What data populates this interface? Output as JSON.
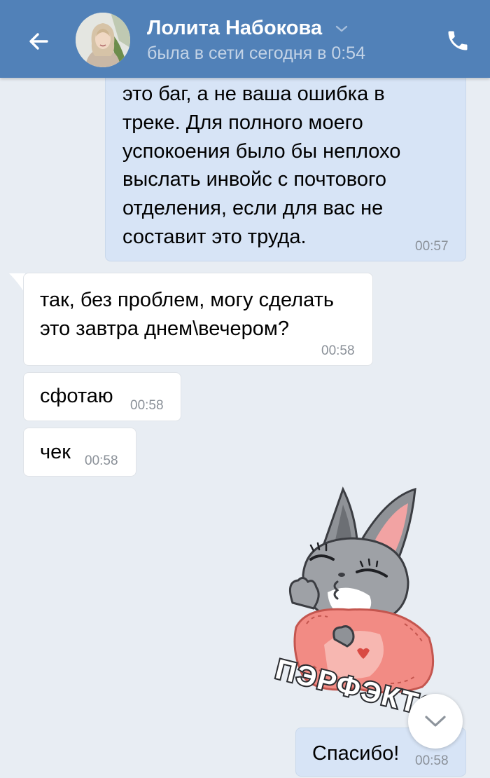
{
  "header": {
    "contact_name": "Лолита Набокова",
    "status": "была в сети сегодня в 0:54",
    "back_icon": "arrow-left-icon",
    "phone_icon": "phone-icon",
    "accent_color": "#5181b8"
  },
  "messages": [
    {
      "direction": "outgoing",
      "text": "это баг, а не ваша ошибка в\nтреке. Для полного моего\nуспокоения было бы неплохо\nвыслать инвойс с почтового\nотделения, если для вас не\nсоставит это труда.",
      "time": "00:57"
    },
    {
      "direction": "incoming",
      "text": "так, без проблем, могу сделать\nэто завтра днем\\вечером?",
      "time": "00:58"
    },
    {
      "direction": "incoming",
      "text": "сфотаю",
      "time": "00:58"
    },
    {
      "direction": "incoming",
      "text": "чек",
      "time": "00:58"
    },
    {
      "direction": "incoming",
      "type": "sticker",
      "sticker_caption": "ПЭРФЭКТО",
      "time_partial": "3"
    },
    {
      "direction": "outgoing",
      "text": "Спасибо!",
      "time": "00:58"
    }
  ],
  "scroll_down_icon": "chevron-down-icon",
  "colors": {
    "background": "#e8edf3",
    "incoming_bubble": "#ffffff",
    "outgoing_bubble": "#d7e4f6"
  }
}
